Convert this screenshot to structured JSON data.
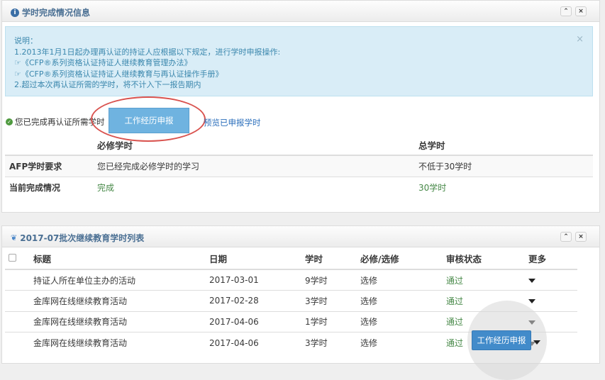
{
  "panel1": {
    "title": "学时完成情况信息",
    "alert": {
      "lines": [
        "说明：",
        "1.2013年1月1日起办理再认证的持证人应根据以下规定，进行学时申报操作:",
        "☞《CFP®系列资格认证持证人继续教育管理办法》",
        "☞《CFP®系列资格认证持证人继续教育与再认证操作手册》",
        "2.超过本次再认证所需的学时，将不计入下一报告期内"
      ],
      "close": "×"
    },
    "status_text": "您已完成再认证所需学时",
    "highlight_button": "工作经历申报",
    "view_link": "预览已申报学时",
    "table": {
      "headers": [
        "",
        "必修学时",
        "总学时"
      ],
      "rows": [
        [
          "AFP学时要求",
          "您已经完成必修学时的学习",
          "不低于30学时"
        ],
        [
          "当前完成情况",
          "完成",
          "30学时"
        ]
      ]
    }
  },
  "panel2": {
    "title": "2017-07批次继续教育学时列表",
    "headers": [
      "标题",
      "日期",
      "学时",
      "必修/选修",
      "审核状态",
      "更多"
    ],
    "rows": [
      [
        "持证人所在单位主办的活动",
        "2017-03-01",
        "9学时",
        "选修",
        "通过"
      ],
      [
        "金库网在线继续教育活动",
        "2017-02-28",
        "3学时",
        "选修",
        "通过"
      ],
      [
        "金库网在线继续教育活动",
        "2017-04-06",
        "1学时",
        "选修",
        "通过"
      ],
      [
        "金库网在线继续教育活动",
        "2017-04-06",
        "3学时",
        "选修",
        "通过"
      ]
    ],
    "float_button": "工作经历申报"
  },
  "controls": {
    "collapse": "⌃",
    "close": "×"
  },
  "colors": {
    "accent": "#428bca",
    "success": "#468847",
    "alert_bg": "#d9edf7",
    "highlight_ring": "#d9534f"
  },
  "icons": [
    "info-icon",
    "check-icon",
    "leaf-icon",
    "chevron-up-icon",
    "close-icon",
    "caret-down-icon",
    "checkbox-icon"
  ]
}
